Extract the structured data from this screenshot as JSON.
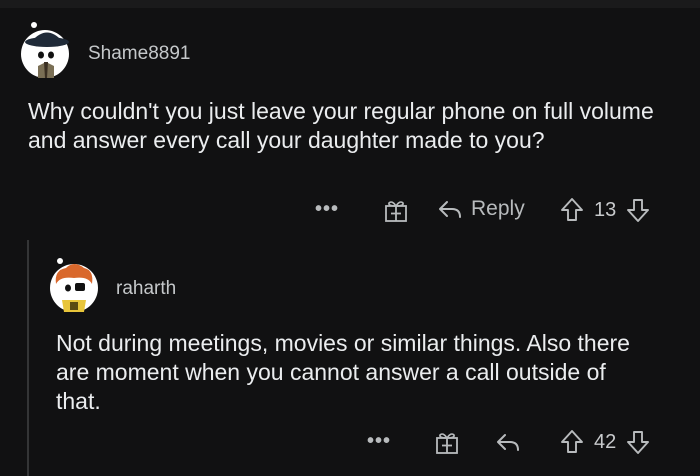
{
  "comment": {
    "username": "Shame8891",
    "body": "Why couldn't you just leave your regular phone on full volume and answer every call your daughter made to you?",
    "actions": {
      "more": "•••",
      "reply_label": "Reply",
      "vote_count": "13"
    },
    "icons": [
      "avatar-icon",
      "more-icon",
      "gift-icon",
      "reply-icon",
      "upvote-icon",
      "downvote-icon"
    ]
  },
  "reply": {
    "username": "raharth",
    "body": "Not during meetings, movies or similar things. Also there are moment when you cannot answer a call outside of that.",
    "actions": {
      "more": "•••",
      "vote_count": "42"
    },
    "icons": [
      "avatar-icon",
      "more-icon",
      "gift-icon",
      "reply-icon",
      "upvote-icon",
      "downvote-icon"
    ]
  },
  "colors": {
    "background": "#111112",
    "text": "#ebedef",
    "muted": "#b8bbbd",
    "thread_line": "#343536"
  }
}
